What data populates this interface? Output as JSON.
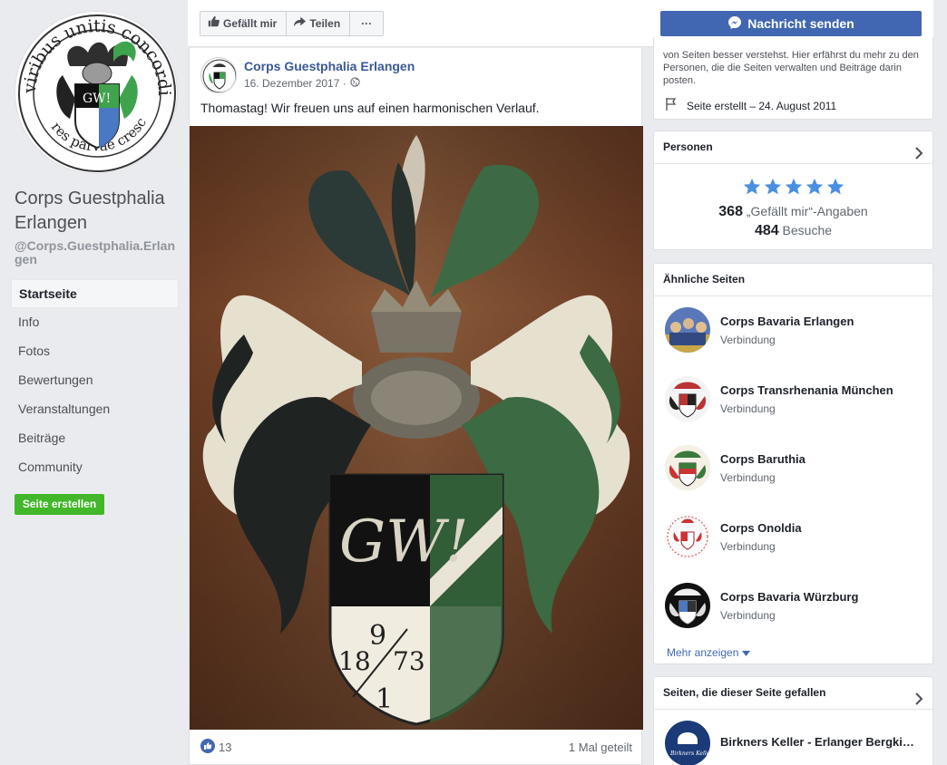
{
  "page": {
    "name": "Corps Guestphalia Erlangen",
    "handle": "@Corps.Guestphalia.Erlangen",
    "profile_text_top": "viribus unitis concordiaque",
    "profile_text_bottom": "res parvae crescunt"
  },
  "nav": {
    "items": [
      {
        "label": "Startseite"
      },
      {
        "label": "Info"
      },
      {
        "label": "Fotos"
      },
      {
        "label": "Bewertungen"
      },
      {
        "label": "Veranstaltungen"
      },
      {
        "label": "Beiträge"
      },
      {
        "label": "Community"
      }
    ],
    "create_label": "Seite erstellen"
  },
  "actions": {
    "like_label": "Gefällt mir",
    "share_label": "Teilen",
    "more_label": "···",
    "message_label": "Nachricht senden"
  },
  "post": {
    "author": "Corps Guestphalia Erlangen",
    "date": "16. Dezember 2017 ·",
    "text": "Thomastag! Wir freuen uns auf einen harmonischen Verlauf.",
    "coat_letters": "GW!",
    "coat_nine": "9",
    "coat_left": "18",
    "coat_right": "73",
    "coat_one": "1",
    "like_count": "13",
    "shares": "1 Mal geteilt"
  },
  "about": {
    "text": "von Seiten besser verstehst. Hier erfährst du mehr zu den Personen, die die Seiten verwalten und Beiträge darin posten.",
    "created": "Seite erstellt – 24. August 2011"
  },
  "people": {
    "title": "Personen",
    "rating": 5,
    "likes_count": "368",
    "likes_label": "„Gefällt mir“-Angaben",
    "visits_count": "484",
    "visits_label": "Besuche"
  },
  "similar": {
    "title": "Ähnliche Seiten",
    "items": [
      {
        "name": "Corps Bavaria Erlangen",
        "category": "Verbindung"
      },
      {
        "name": "Corps Transrhenania München",
        "category": "Verbindung"
      },
      {
        "name": "Corps Baruthia",
        "category": "Verbindung"
      },
      {
        "name": "Corps Onoldia",
        "category": "Verbindung"
      },
      {
        "name": "Corps Bavaria Würzburg",
        "category": "Verbindung"
      }
    ],
    "more_label": "Mehr anzeigen"
  },
  "liked_pages": {
    "title": "Seiten, die dieser Seite gefallen",
    "items": [
      {
        "name": "Birkners Keller - Erlanger Bergki…",
        "logo_text": "Birkners Keller"
      }
    ]
  },
  "colors": {
    "fb_blue": "#4267b2",
    "link_blue": "#385898",
    "green": "#42b72a",
    "star": "#4a90e2",
    "wood": "#7a4a2e"
  }
}
